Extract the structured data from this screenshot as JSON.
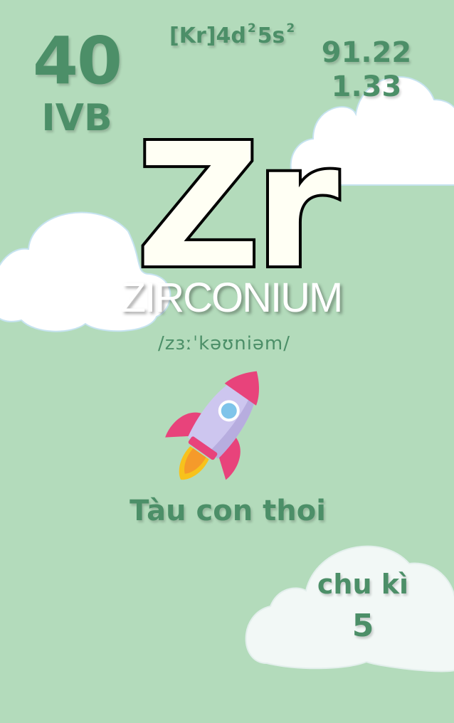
{
  "element": {
    "atomic_number": "40",
    "group": "IVB",
    "configuration_base": "[Kr]4d",
    "configuration_exp1": "2",
    "configuration_mid": "5s",
    "configuration_exp2": "2",
    "atomic_mass": "91.22",
    "electronegativity": "1.33",
    "symbol": "Zr",
    "name": "ZIRCONIUM",
    "pronunciation": "/zɜːˈkəʊniəm/"
  },
  "illustration": {
    "icon": "rocket-icon",
    "label": "Tàu con thoi"
  },
  "period": {
    "label": "chu kì",
    "value": "5"
  },
  "colors": {
    "background": "#b3dbbb",
    "accent_text": "#4c8f68",
    "cloud": "#ffffff"
  }
}
